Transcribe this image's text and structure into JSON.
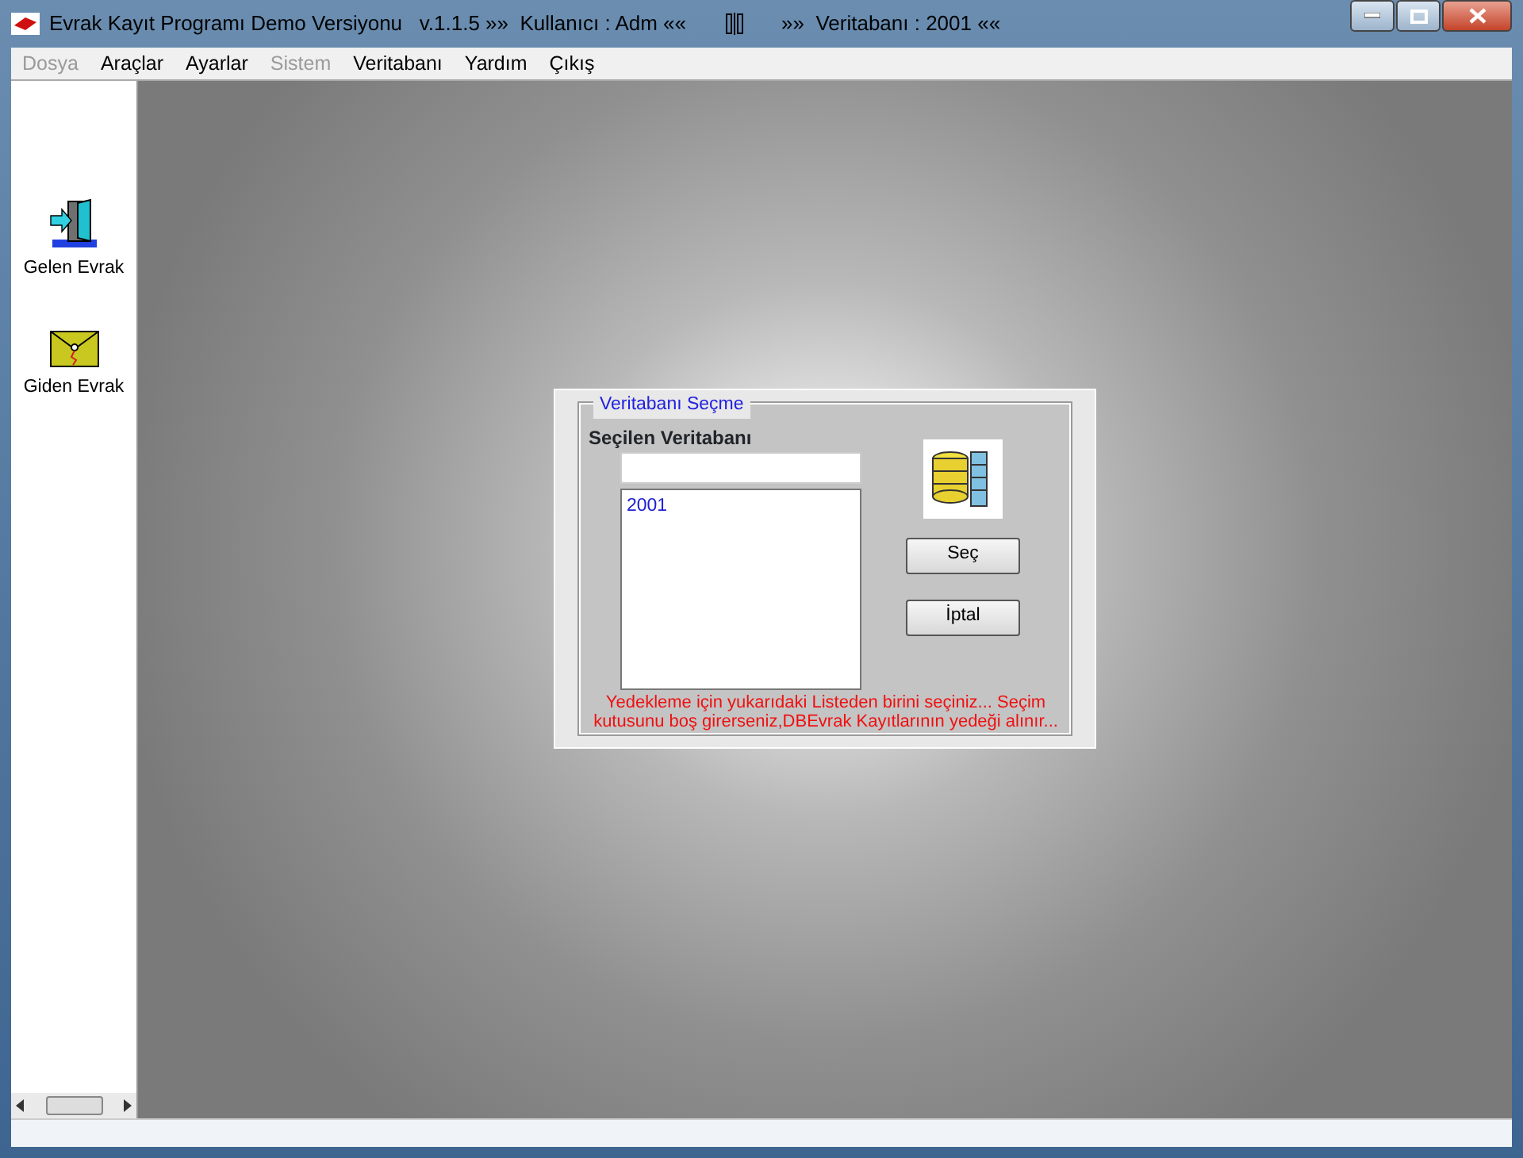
{
  "window": {
    "title": "Evrak Kayıt Programı Demo Versiyonu   v.1.1.5 »»  Kullanıcı : Adm ««",
    "title_db": "»»  Veritabanı : 2001 ««"
  },
  "menu": [
    {
      "label": "Dosya",
      "disabled": true
    },
    {
      "label": "Araçlar",
      "disabled": false
    },
    {
      "label": "Ayarlar",
      "disabled": false
    },
    {
      "label": "Sistem",
      "disabled": true
    },
    {
      "label": "Veritabanı",
      "disabled": false
    },
    {
      "label": "Yardım",
      "disabled": false
    },
    {
      "label": "Çıkış",
      "disabled": false
    }
  ],
  "sidebar": {
    "items": [
      {
        "label": "Gelen Evrak",
        "kind": "incoming"
      },
      {
        "label": "Giden Evrak",
        "kind": "outgoing"
      }
    ]
  },
  "dialog": {
    "group_title": "Veritabanı  Seçme",
    "field_label": "Seçilen Veritabanı",
    "list_items": [
      {
        "label": "2001",
        "selected": false
      }
    ],
    "buttons": [
      "Seç",
      "İptal"
    ],
    "message": "Yedekleme için yukarıdaki Listeden birini seçiniz...  Seçim kutusunu boş girerseniz,DBEvrak Kayıtlarının yedeği alınır..."
  }
}
